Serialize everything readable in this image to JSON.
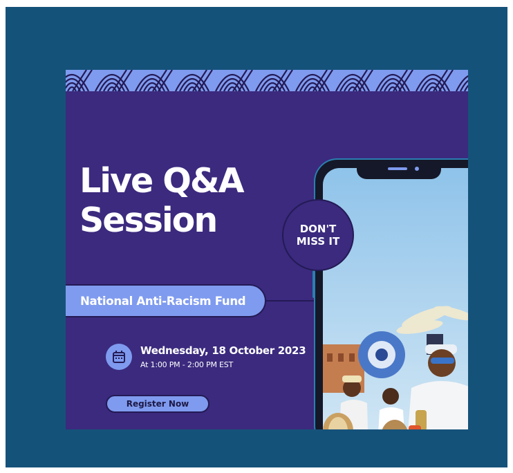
{
  "event": {
    "title_line1": "Live Q&A",
    "title_line2": "Session",
    "badge_line1": "DON'T",
    "badge_line2": "MISS IT",
    "organization": "National Anti-Racism Fund",
    "date": "Wednesday, 18 October 2023",
    "time": "At 1:00 PM - 2:00 PM EST",
    "register_label": "Register Now"
  },
  "icons": {
    "calendar": "calendar-icon",
    "pattern": "wave-pattern"
  },
  "colors": {
    "outer_frame": "#15527a",
    "card_background": "#3b2a7e",
    "accent": "#7f9bef",
    "outline": "#241a55",
    "text": "#ffffff"
  }
}
